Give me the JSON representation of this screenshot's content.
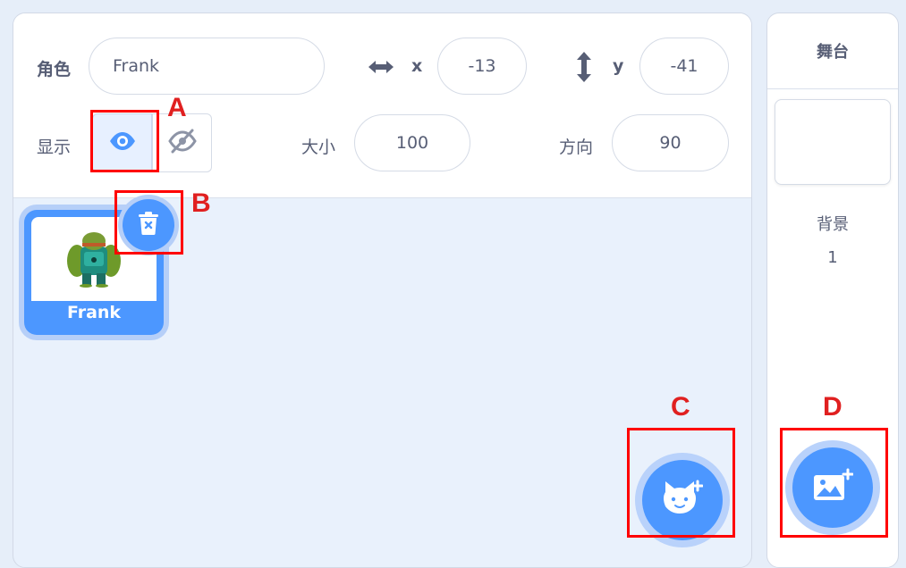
{
  "sprite_info": {
    "sprite_label": "角色",
    "sprite_name_value": "Frank",
    "x_label": "x",
    "x_value": "-13",
    "y_label": "y",
    "y_value": "-41",
    "show_label": "显示",
    "size_label": "大小",
    "size_value": "100",
    "direction_label": "方向",
    "direction_value": "90"
  },
  "sprite_list": {
    "items": [
      {
        "name": "Frank",
        "selected": true
      }
    ]
  },
  "stage_panel": {
    "title": "舞台",
    "backdrops_label": "背景",
    "backdrops_count": "1"
  },
  "annotations": {
    "A": "A",
    "B": "B",
    "C": "C",
    "D": "D"
  },
  "icons": {
    "show": "eye-icon",
    "hide": "eye-slash-icon",
    "delete": "trash-icon",
    "add_sprite": "cat-plus-icon",
    "add_backdrop": "image-plus-icon",
    "x": "horizontal-arrows-icon",
    "y": "vertical-arrows-icon"
  },
  "colors": {
    "accent": "#4c97ff",
    "accent_halo": "#b9d2fb",
    "annotation": "#ff0000"
  }
}
